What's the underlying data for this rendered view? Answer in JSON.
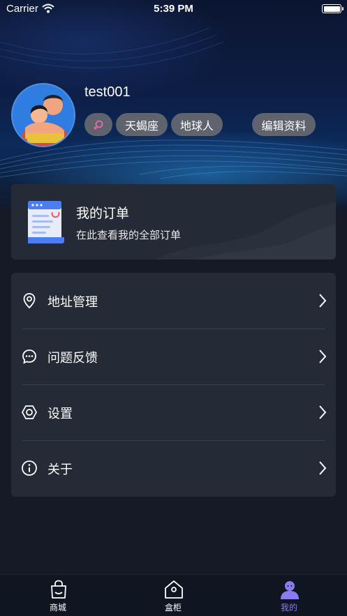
{
  "status_bar": {
    "carrier": "Carrier",
    "time": "5:39 PM",
    "icons": [
      "wifi-icon",
      "battery-icon"
    ]
  },
  "profile": {
    "username": "test001",
    "gender_icon": "female-symbol-icon",
    "gender_color": "#e868b0",
    "tags": [
      "天蝎座",
      "地球人"
    ],
    "edit_label": "编辑资料"
  },
  "order_card": {
    "title": "我的订单",
    "subtitle": "在此查看我的全部订单",
    "icon": "order-document-icon"
  },
  "menu": [
    {
      "label": "地址管理",
      "icon": "location-pin-icon"
    },
    {
      "label": "问题反馈",
      "icon": "chat-bubble-icon"
    },
    {
      "label": "设置",
      "icon": "hexagon-settings-icon"
    },
    {
      "label": "关于",
      "icon": "info-icon"
    }
  ],
  "tabbar": {
    "items": [
      {
        "label": "商城",
        "icon": "shopping-bag-icon"
      },
      {
        "label": "盒柜",
        "icon": "home-box-icon"
      },
      {
        "label": "我的",
        "icon": "user-profile-icon"
      }
    ],
    "active_index": 2,
    "active_color": "#8a7cf0"
  },
  "colors": {
    "background": "#151a26",
    "card": "#252a37",
    "tag": "#6e6e73"
  }
}
